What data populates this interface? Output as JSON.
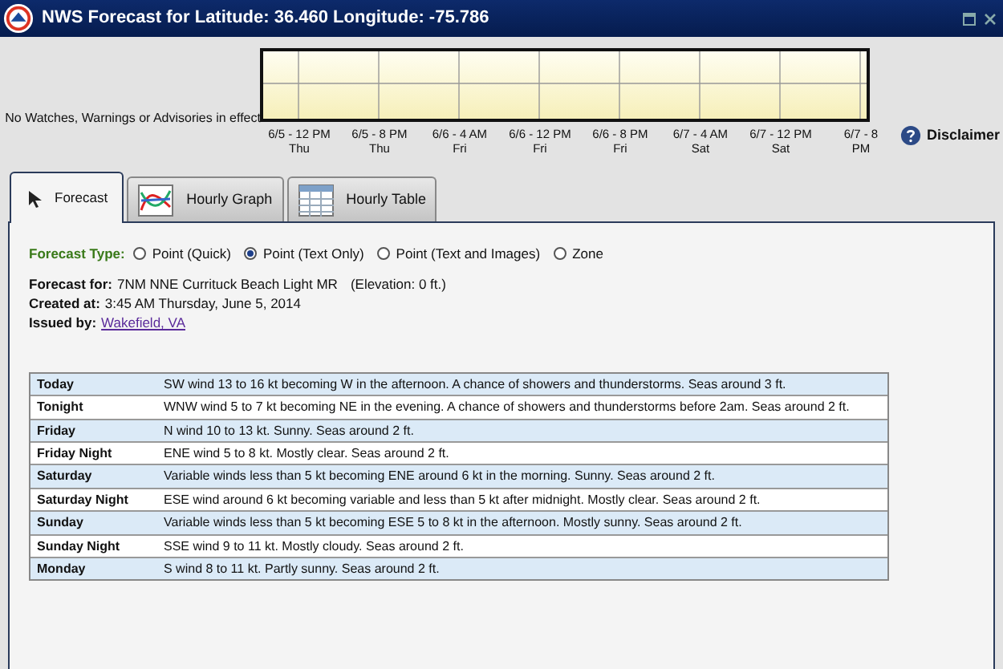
{
  "window": {
    "title": "NWS Forecast for Latitude: 36.460 Longitude: -75.786"
  },
  "alerts": {
    "text": "No Watches, Warnings or Advisories in effect",
    "timeline_labels": [
      {
        "time": "6/5 - 12 PM",
        "day": "Thu"
      },
      {
        "time": "6/5 - 8 PM",
        "day": "Thu"
      },
      {
        "time": "6/6 - 4 AM",
        "day": "Fri"
      },
      {
        "time": "6/6 - 12 PM",
        "day": "Fri"
      },
      {
        "time": "6/6 - 8 PM",
        "day": "Fri"
      },
      {
        "time": "6/7 - 4 AM",
        "day": "Sat"
      },
      {
        "time": "6/7 - 12 PM",
        "day": "Sat"
      },
      {
        "time": "6/7 - 8",
        "day": "PM"
      }
    ]
  },
  "disclaimer": "Disclaimer",
  "tabs": [
    {
      "label": "Forecast",
      "kind": "cursor",
      "selected": true
    },
    {
      "label": "Hourly Graph",
      "kind": "graph",
      "selected": false
    },
    {
      "label": "Hourly Table",
      "kind": "table",
      "selected": false
    }
  ],
  "forecast_type": {
    "label": "Forecast Type:",
    "options": [
      {
        "label": "Point (Quick)",
        "selected": false
      },
      {
        "label": "Point (Text Only)",
        "selected": true
      },
      {
        "label": "Point (Text and Images)",
        "selected": false
      },
      {
        "label": "Zone",
        "selected": false
      }
    ]
  },
  "info": {
    "forecast_for_label": "Forecast for:",
    "forecast_for": "7NM NNE Currituck Beach Light MR",
    "elevation": "(Elevation: 0 ft.)",
    "created_label": "Created at:",
    "created": "3:45 AM Thursday, June 5, 2014",
    "issued_label": "Issued by:",
    "issued_by": "Wakefield, VA"
  },
  "forecast": [
    {
      "period": "Today",
      "text": "SW wind 13 to 16 kt becoming W in the afternoon. A chance of showers and thunderstorms. Seas around 3 ft."
    },
    {
      "period": "Tonight",
      "text": "WNW wind 5 to 7 kt becoming NE in the evening. A chance of showers and thunderstorms before 2am. Seas around 2 ft."
    },
    {
      "period": "Friday",
      "text": "N wind 10 to 13 kt. Sunny. Seas around 2 ft."
    },
    {
      "period": "Friday Night",
      "text": "ENE wind 5 to 8 kt. Mostly clear. Seas around 2 ft."
    },
    {
      "period": "Saturday",
      "text": "Variable winds less than 5 kt becoming ENE around 6 kt in the morning. Sunny. Seas around 2 ft."
    },
    {
      "period": "Saturday Night",
      "text": "ESE wind around 6 kt becoming variable and less than 5 kt after midnight. Mostly clear. Seas around 2 ft."
    },
    {
      "period": "Sunday",
      "text": "Variable winds less than 5 kt becoming ESE 5 to 8 kt in the afternoon. Mostly sunny. Seas around 2 ft."
    },
    {
      "period": "Sunday Night",
      "text": "SSE wind 9 to 11 kt. Mostly cloudy. Seas around 2 ft."
    },
    {
      "period": "Monday",
      "text": "S wind 8 to 11 kt. Partly sunny. Seas around 2 ft."
    }
  ]
}
